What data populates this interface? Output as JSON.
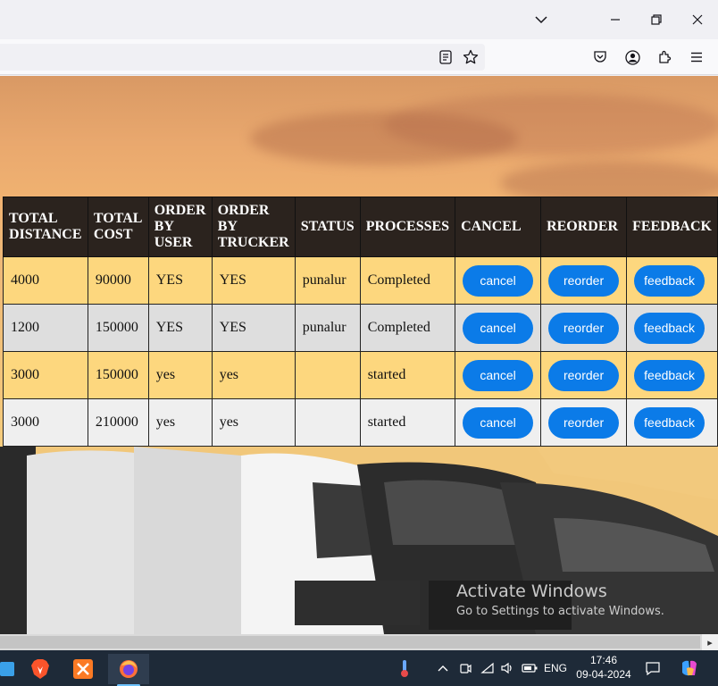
{
  "browser": {
    "title_controls": [
      "list-tabs",
      "minimize",
      "restore",
      "close"
    ]
  },
  "table": {
    "headers": [
      "TOTAL DISTANCE",
      "TOTAL COST",
      "ORDER BY USER",
      "ORDER BY TRUCKER",
      "STATUS",
      "PROCESSES",
      "CANCEL",
      "REORDER",
      "FEEDBACK"
    ],
    "rows": [
      {
        "distance": "4000",
        "cost": "90000",
        "by_user": "YES",
        "by_trucker": "YES",
        "status": "punalur",
        "process": "Completed"
      },
      {
        "distance": "1200",
        "cost": "150000",
        "by_user": "YES",
        "by_trucker": "YES",
        "status": "punalur",
        "process": "Completed"
      },
      {
        "distance": "3000",
        "cost": "150000",
        "by_user": "yes",
        "by_trucker": "yes",
        "status": "",
        "process": "started"
      },
      {
        "distance": "3000",
        "cost": "210000",
        "by_user": "yes",
        "by_trucker": "yes",
        "status": "",
        "process": "started"
      }
    ],
    "cancel_label": "cancel",
    "reorder_label": "reorder",
    "feedback_label": "feedback"
  },
  "watermark": {
    "line1": "Activate Windows",
    "line2": "Go to Settings to activate Windows."
  },
  "taskbar": {
    "language": "ENG",
    "time": "17:46",
    "date": "09-04-2024"
  },
  "colors": {
    "header_bg": "#2b231e",
    "row_yellow": "#fdd77e",
    "row_gray": "#dedede",
    "button_blue": "#0b7be8"
  }
}
